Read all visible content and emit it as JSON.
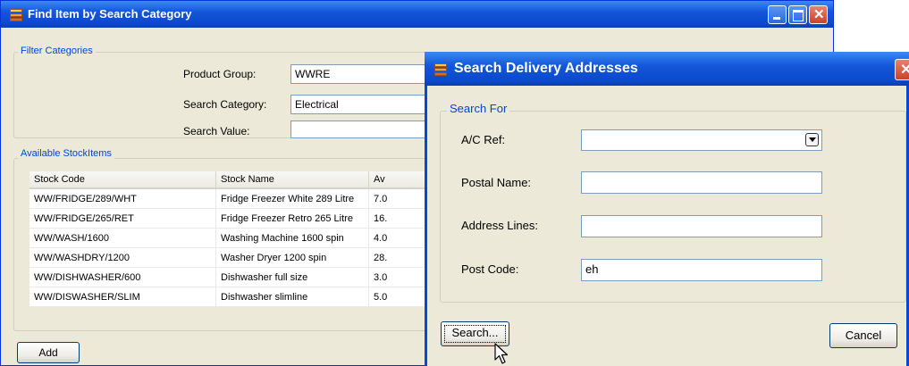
{
  "find_window": {
    "title": "Find Item by Search Category",
    "filter_group": {
      "legend": "Filter Categories",
      "product_group_label": "Product Group:",
      "product_group_value": "WWRE",
      "search_category_label": "Search Category:",
      "search_category_value": "Electrical",
      "search_value_label": "Search Value:",
      "search_value_value": ""
    },
    "stock_group": {
      "legend": "Available StockItems",
      "columns": [
        "Stock Code",
        "Stock Name",
        "Av"
      ],
      "rows": [
        {
          "code": "WW/FRIDGE/289/WHT",
          "name": "Fridge Freezer White 289 Litre",
          "av": "7.0"
        },
        {
          "code": "WW/FRIDGE/265/RET",
          "name": "Fridge Freezer Retro 265 Litre",
          "av": "16."
        },
        {
          "code": "WW/WASH/1600",
          "name": "Washing Machine 1600 spin",
          "av": "4.0"
        },
        {
          "code": "WW/WASHDRY/1200",
          "name": "Washer Dryer 1200 spin",
          "av": "28."
        },
        {
          "code": "WW/DISHWASHER/600",
          "name": "Dishwasher full size",
          "av": "3.0"
        },
        {
          "code": "WW/DISWASHER/SLIM",
          "name": "Dishwasher slimline",
          "av": "5.0"
        }
      ]
    },
    "add_label": "Add"
  },
  "search_dialog": {
    "title": "Search Delivery Addresses",
    "legend": "Search For",
    "ac_ref_label": "A/C Ref:",
    "ac_ref_value": "",
    "postal_name_label": "Postal Name:",
    "postal_name_value": "",
    "address_lines_label": "Address Lines:",
    "address_lines_value": "",
    "post_code_label": "Post Code:",
    "post_code_value": "eh",
    "search_label": "Search...",
    "cancel_label": "Cancel"
  },
  "colors": {
    "titlebar": "#0b49cc",
    "dialog_face": "#ece9d8",
    "legend_text": "#0046d5"
  }
}
